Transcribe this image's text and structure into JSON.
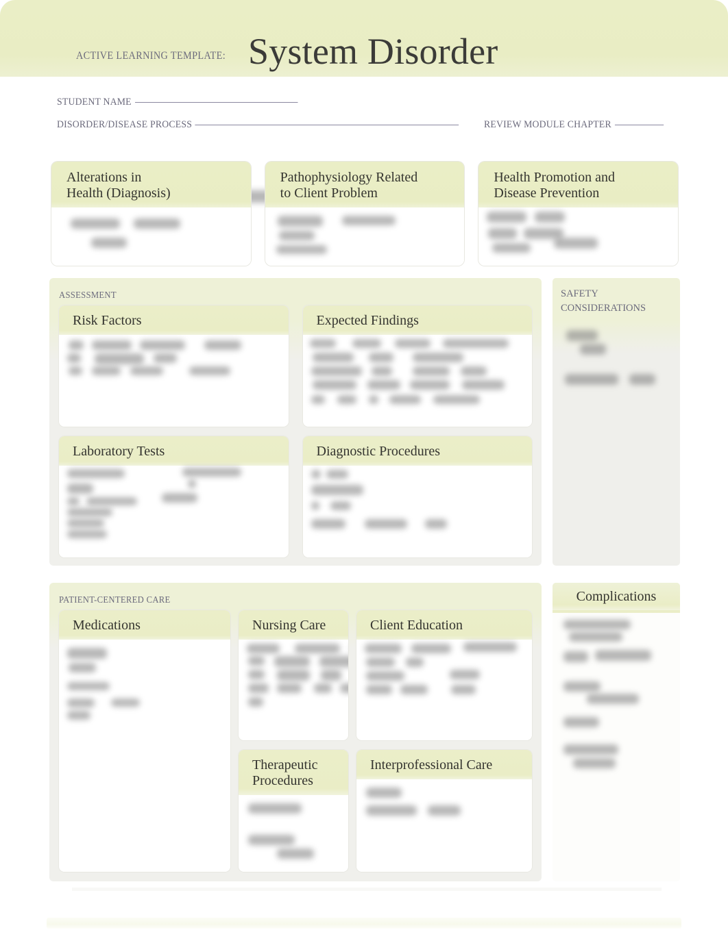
{
  "header": {
    "eyebrow": "ACTIVE LEARNING TEMPLATE:",
    "title": "System Disorder"
  },
  "meta": {
    "student_name_label": "STUDENT NAME",
    "student_name_value": "",
    "disorder_label": "DISORDER/DISEASE PROCESS",
    "disorder_value": "",
    "review_chapter_label": "REVIEW MODULE CHAPTER",
    "review_chapter_value": ""
  },
  "top_boxes": [
    {
      "title": "Alterations in\nHealth (Diagnosis)",
      "content": ""
    },
    {
      "title": "Pathophysiology Related\nto Client Problem",
      "content": ""
    },
    {
      "title": "Health Promotion and\nDisease Prevention",
      "content": ""
    }
  ],
  "assessment": {
    "section_label": "ASSESSMENT",
    "boxes": [
      {
        "title": "Risk Factors",
        "content": ""
      },
      {
        "title": "Expected Findings",
        "content": ""
      },
      {
        "title": "Laboratory Tests",
        "content": ""
      },
      {
        "title": "Diagnostic Procedures",
        "content": ""
      }
    ]
  },
  "safety": {
    "label": "SAFETY CONSIDERATIONS",
    "content": ""
  },
  "patient_centered_care": {
    "section_label": "PATIENT-CENTERED CARE",
    "boxes": [
      {
        "title": "Nursing Care",
        "content": ""
      },
      {
        "title": "Medications",
        "content": ""
      },
      {
        "title": "Client Education",
        "content": ""
      },
      {
        "title": "Therapeutic Procedures",
        "content": ""
      },
      {
        "title": "Interprofessional Care",
        "content": ""
      }
    ]
  },
  "complications": {
    "title": "Complications",
    "content": ""
  },
  "colors": {
    "band": "#e9edc4",
    "panel_tint": "#eef1d7",
    "panel_body": "#f0f0ec",
    "label_text": "#6b6a7c",
    "heading_text": "#34342f",
    "card": "#ffffff"
  }
}
